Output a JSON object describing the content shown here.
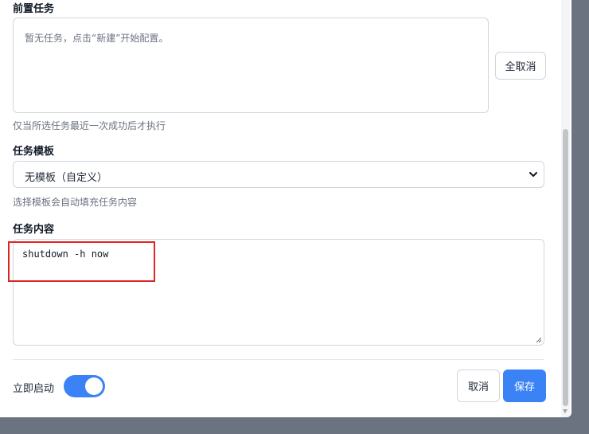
{
  "prerequisite": {
    "label": "前置任务",
    "empty_text": "暂无任务，点击“新建”开始配置。",
    "deselect_all_label": "全取消",
    "hint": "仅当所选任务最近一次成功后才执行"
  },
  "template": {
    "label": "任务模板",
    "selected": "无模板（自定义）",
    "hint": "选择模板会自动填充任务内容"
  },
  "content": {
    "label": "任务内容",
    "value": "shutdown -h now"
  },
  "footer": {
    "start_now_label": "立即启动",
    "start_now_on": true,
    "cancel_label": "取消",
    "save_label": "保存"
  },
  "colors": {
    "primary": "#3b82f6",
    "highlight_border": "#dc2626"
  }
}
